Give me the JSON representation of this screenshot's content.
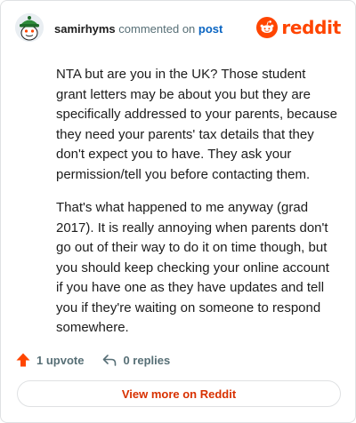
{
  "header": {
    "username": "samirhyms",
    "action_text": "commented on",
    "post_link": "post",
    "brand_name": "reddit"
  },
  "comment": {
    "paragraphs": [
      "NTA but are you in the UK? Those student grant letters may be about you but they are specifically addressed to your parents, because they need your parents' tax details that they don't expect you to have. They ask your permission/tell you before contacting them.",
      "That's what happened to me anyway (grad 2017). It is really annoying when parents don't go out of their way to do it on time though, but you should keep checking your online account if you have one as they have updates and tell you if they're waiting on someone to respond somewhere."
    ]
  },
  "actions": {
    "upvote_label": "1 upvote",
    "replies_label": "0 replies"
  },
  "footer": {
    "view_more_label": "View more on Reddit"
  },
  "colors": {
    "brand": "#ff4500",
    "link": "#0a65c2",
    "view_more": "#d83100",
    "muted": "#576f76"
  },
  "icons": {
    "avatar": "snoo-avatar-green-hat",
    "brand_logo": "reddit-logo-icon",
    "upvote": "upvote-arrow-icon",
    "reply": "reply-arrow-icon"
  }
}
